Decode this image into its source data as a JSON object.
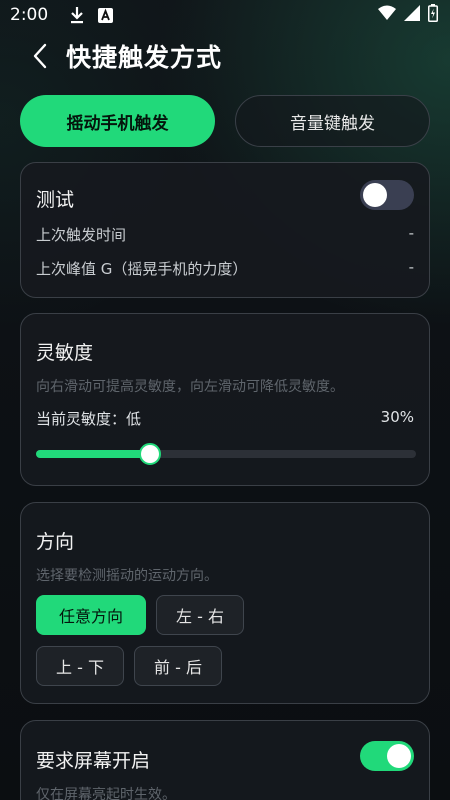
{
  "status_bar": {
    "time": "2:00",
    "left_icons": [
      "download-icon",
      "keyboard-a-icon"
    ],
    "right_icons": [
      "wifi-icon",
      "signal-icon",
      "battery-icon"
    ]
  },
  "header": {
    "title": "快捷触发方式"
  },
  "tabs": [
    {
      "label": "摇动手机触发",
      "active": true
    },
    {
      "label": "音量键触发",
      "active": false
    }
  ],
  "test_card": {
    "title": "测试",
    "toggle_on": false,
    "last_trigger_time_label": "上次触发时间",
    "last_trigger_time_value": "-",
    "last_peak_label": "上次峰值 G（摇晃手机的力度）",
    "last_peak_value": "-"
  },
  "sensitivity_card": {
    "title": "灵敏度",
    "description": "向右滑动可提高灵敏度，向左滑动可降低灵敏度。",
    "current_label": "当前灵敏度：低",
    "percent_text": "30%",
    "value": 0.3
  },
  "direction_card": {
    "title": "方向",
    "description": "选择要检测摇动的运动方向。",
    "options": [
      {
        "label": "任意方向",
        "selected": true
      },
      {
        "label": "左 - 右",
        "selected": false
      },
      {
        "label": "上 - 下",
        "selected": false
      },
      {
        "label": "前 - 后",
        "selected": false
      }
    ]
  },
  "screen_card": {
    "title": "要求屏幕开启",
    "description": "仅在屏幕亮起时生效。",
    "toggle_on": true
  },
  "colors": {
    "accent": "#21d97a",
    "background": "#0c1014",
    "card": "#16191e",
    "border": "#3a3f46"
  }
}
